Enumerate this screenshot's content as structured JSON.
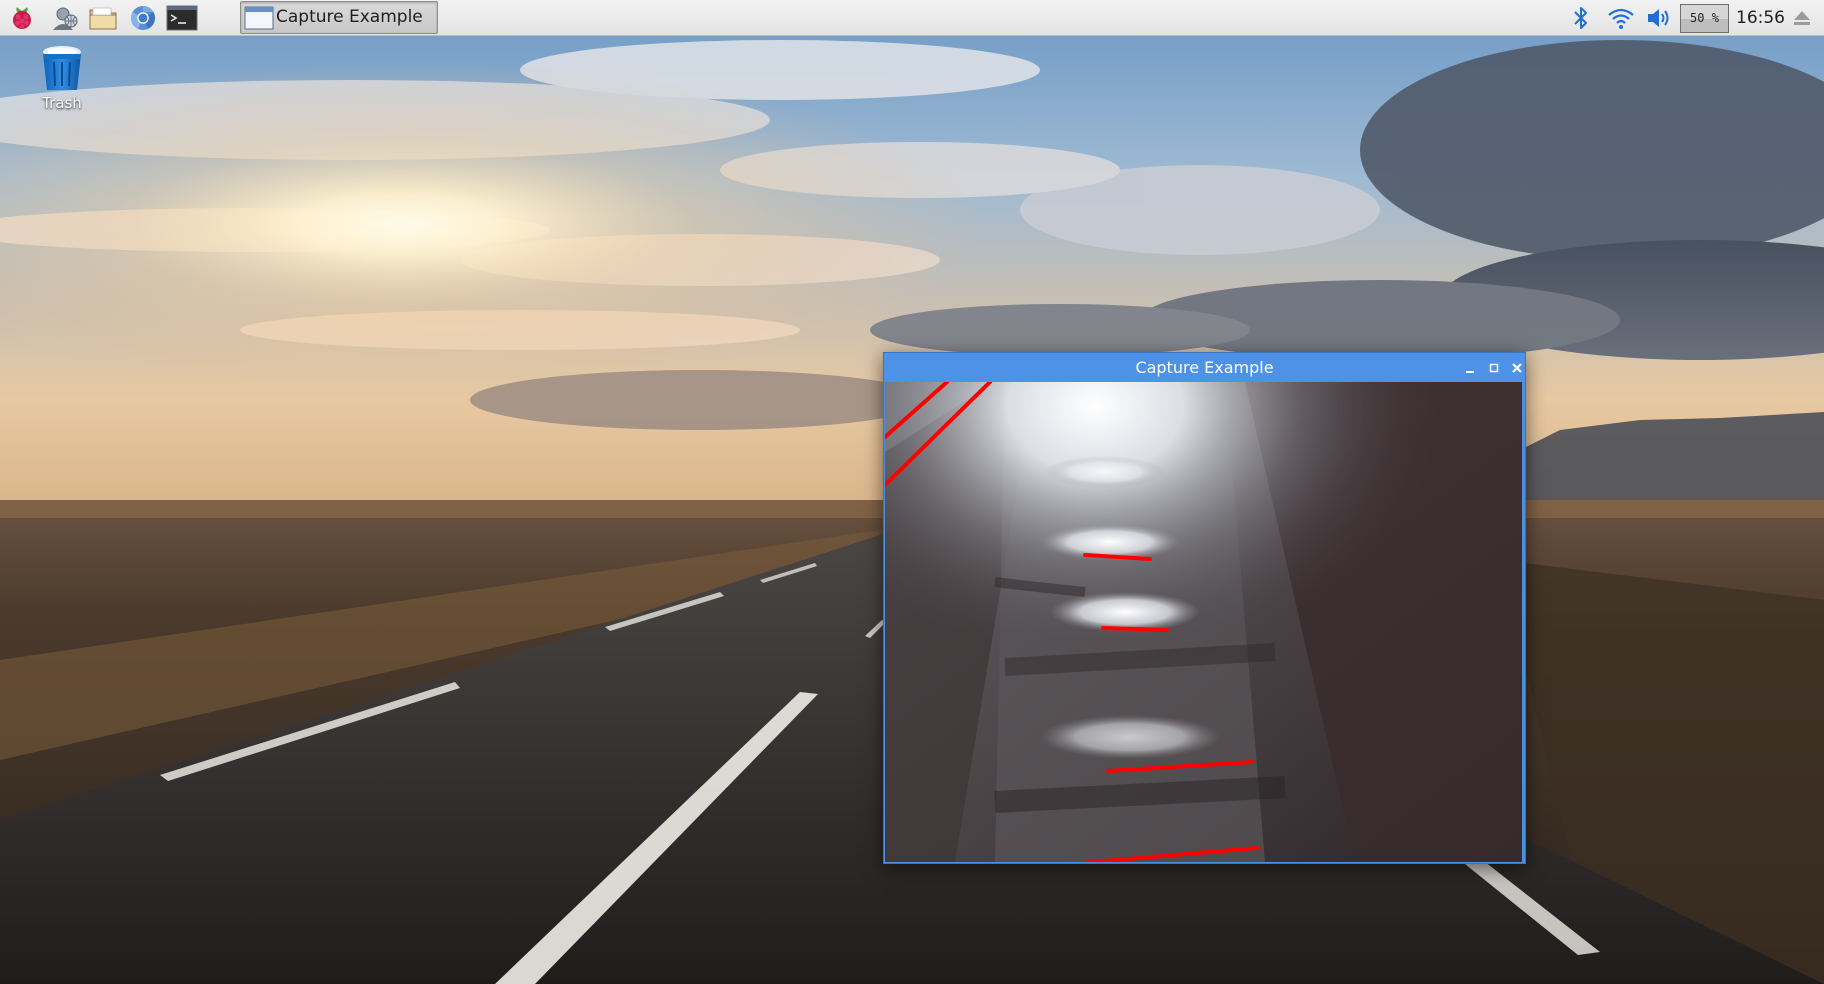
{
  "desktop": {
    "icons": [
      {
        "label": "Trash",
        "icon": "trash-bin-icon"
      }
    ]
  },
  "taskbar": {
    "launchers": [
      {
        "name": "raspberry-menu",
        "icon": "raspberry-icon"
      },
      {
        "name": "web-browser-user",
        "icon": "user-globe-icon"
      },
      {
        "name": "file-manager",
        "icon": "folder-icon"
      },
      {
        "name": "chromium-browser",
        "icon": "chromium-icon"
      },
      {
        "name": "terminal",
        "icon": "terminal-icon"
      }
    ],
    "task": {
      "label": "Capture Example",
      "icon": "window-icon"
    },
    "tray": {
      "bluetooth_icon": "bluetooth-icon",
      "wifi_icon": "wifi-icon",
      "volume_icon": "volume-icon",
      "cpu_usage": "50 %",
      "cpu_usage_value": 50,
      "clock": "16:56",
      "eject_icon": "eject-icon"
    }
  },
  "window": {
    "title": "Capture Example",
    "controls": [
      "minimize",
      "maximize",
      "close"
    ],
    "content": {
      "description_icon": "camera-frame",
      "overlay_color": "#ff0000"
    }
  },
  "colors": {
    "title_bar": "#4d92e6",
    "panel": "#ececec",
    "detected_line": "#ff0000"
  }
}
